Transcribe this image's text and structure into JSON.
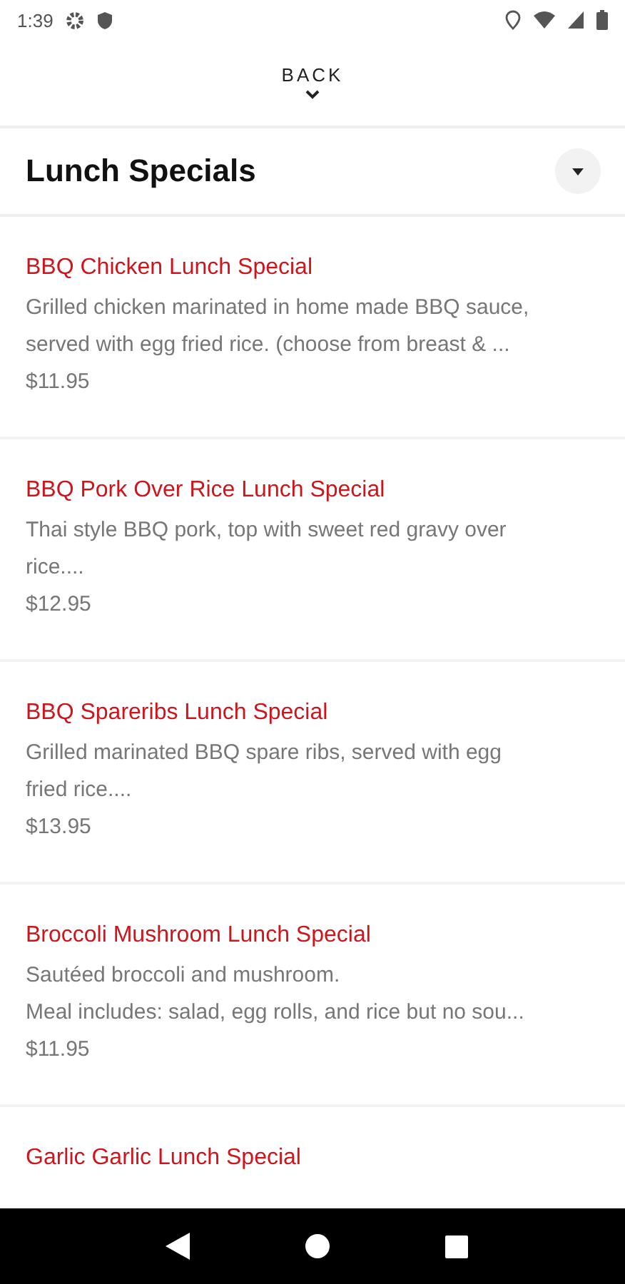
{
  "status_bar": {
    "time": "1:39"
  },
  "back": {
    "label": "BACK"
  },
  "section": {
    "title": "Lunch Specials",
    "expanded": true
  },
  "items": [
    {
      "name": "BBQ Chicken Lunch Special",
      "description": "Grilled chicken marinated in home made BBQ sauce,\nserved with egg fried rice. (choose from breast & ...",
      "price": "$11.95"
    },
    {
      "name": "BBQ Pork Over Rice Lunch Special",
      "description": "Thai style BBQ pork, top with sweet red gravy over\nrice....",
      "price": "$12.95"
    },
    {
      "name": "BBQ Spareribs Lunch Special",
      "description": "Grilled marinated BBQ spare ribs, served with egg\nfried rice....",
      "price": "$13.95"
    },
    {
      "name": "Broccoli Mushroom Lunch Special",
      "description": "Sautéed broccoli and mushroom.\nMeal includes: salad, egg rolls, and rice but no sou...",
      "price": "$11.95"
    },
    {
      "name": "Garlic Garlic Lunch Special"
    }
  ]
}
